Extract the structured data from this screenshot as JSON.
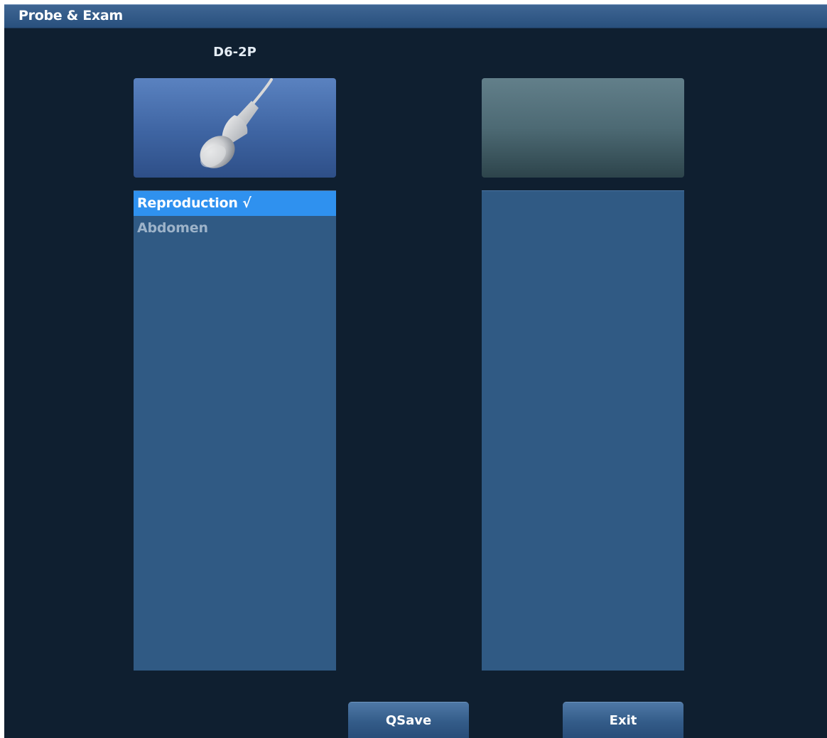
{
  "window": {
    "title": "Probe & Exam"
  },
  "probes": [
    {
      "name": "D6-2P",
      "icon": "convex-probe-icon"
    },
    {
      "name": "",
      "icon": ""
    }
  ],
  "exams": {
    "left": [
      {
        "label": "Reproduction √",
        "selected": true
      },
      {
        "label": "Abdomen",
        "selected": false
      }
    ],
    "right": []
  },
  "buttons": {
    "qsave": "QSave",
    "exit": "Exit"
  },
  "colors": {
    "background": "#0f1f30",
    "selected_item": "#2f91ef",
    "list_bg": "#305a84",
    "unselected_text": "#9db3c9"
  }
}
